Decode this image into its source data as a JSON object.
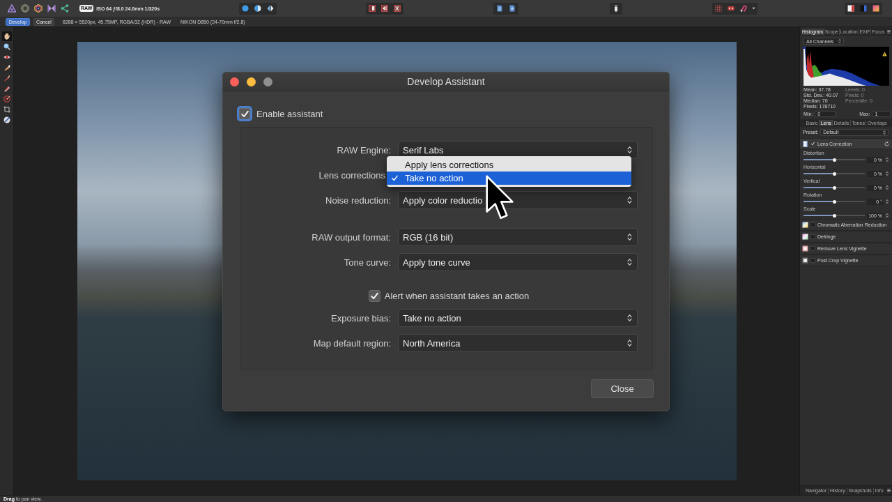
{
  "toolbar": {
    "raw_badge": "RAW",
    "exposure_info": "ISO 64 ƒ/8.0 24.0mm 1/320s"
  },
  "context_bar": {
    "buttons": [
      {
        "label": "Develop",
        "selected": true
      },
      {
        "label": "Cancel",
        "selected": false
      }
    ],
    "image_info": "8288 × 5520px, 45.75MP, RGBA/32 (HDR) - RAW",
    "camera_info": "NIKON D850 (24-70mm f/2.8)"
  },
  "tools": [
    {
      "selected": true
    },
    {
      "selected": false
    },
    {
      "selected": false
    },
    {
      "selected": false
    },
    {
      "selected": false
    },
    {
      "selected": false
    },
    {
      "selected": false
    },
    {
      "selected": false
    },
    {
      "selected": false
    }
  ],
  "dialog": {
    "title": "Develop Assistant",
    "window_buttons": [
      {
        "kind": "close",
        "disabled": false
      },
      {
        "kind": "minimize",
        "disabled": false
      },
      {
        "kind": "zoom",
        "disabled": true
      }
    ],
    "enable_assistant": {
      "label": "Enable assistant",
      "checked": true,
      "focused": true
    },
    "sections": [
      {
        "rows": [
          {
            "kind": "popup",
            "label": "RAW Engine:",
            "value": "Serif Labs"
          },
          {
            "kind": "popup",
            "label": "Lens corrections",
            "menu": [
              {
                "label": "Apply lens corrections",
                "selected": false
              },
              {
                "label": "Take no action",
                "selected": true
              }
            ]
          },
          {
            "kind": "popup",
            "label": "Noise reduction:",
            "value": "Apply color reductio"
          }
        ]
      },
      {
        "rows": [
          {
            "kind": "popup",
            "label": "RAW output format:",
            "value": "RGB (16 bit)"
          },
          {
            "kind": "popup",
            "label": "Tone curve:",
            "value": "Apply tone curve"
          }
        ]
      },
      {
        "rows": [
          {
            "kind": "checkbox",
            "label": "Alert when assistant takes an action",
            "checked": true
          },
          {
            "kind": "popup",
            "label": "Exposure bias:",
            "value": "Take no action"
          },
          {
            "kind": "popup",
            "label": "Map default region:",
            "value": "North America"
          }
        ]
      }
    ],
    "close_button": "Close"
  },
  "right_panel": {
    "tabs": [
      {
        "label": "Histogram",
        "selected": true
      },
      {
        "label": "Scope",
        "selected": false
      },
      {
        "label": "Location",
        "selected": false
      },
      {
        "label": "EXIF",
        "selected": false
      },
      {
        "label": "Focus",
        "selected": false
      }
    ],
    "channel_select": "All Channels",
    "stats": {
      "left": [
        {
          "text": "Mean: 37.78",
          "disabled": false
        },
        {
          "text": "Std. Dev.: 40.07",
          "disabled": false
        },
        {
          "text": "Median: 70",
          "disabled": false
        },
        {
          "text": "Pixels: 178710",
          "disabled": false
        }
      ],
      "right": [
        {
          "text": "Levels: 0",
          "disabled": true
        },
        {
          "text": "Pixels: 0",
          "disabled": true
        },
        {
          "text": "Percentile: 0",
          "disabled": true
        }
      ]
    },
    "min": {
      "label": "Min:",
      "value": "0"
    },
    "max": {
      "label": "Max:",
      "value": "1"
    },
    "adjust_tabs": [
      {
        "label": "Basic",
        "selected": false
      },
      {
        "label": "Lens",
        "selected": true
      },
      {
        "label": "Details",
        "selected": false
      },
      {
        "label": "Tones",
        "selected": false
      },
      {
        "label": "Overlays",
        "selected": false
      }
    ],
    "preset": {
      "label": "Preset:",
      "value": "Default"
    },
    "sections": [
      {
        "title": "Lens Correction",
        "checked": true,
        "expanded": true,
        "sliders": [
          {
            "label": "Distortion",
            "level": 0.5,
            "reading": "0 %"
          },
          {
            "label": "Horizontal",
            "level": 0.5,
            "reading": "0 %"
          },
          {
            "label": "Vertical",
            "level": 0.5,
            "reading": "0 %"
          },
          {
            "label": "Rotation",
            "level": 0.5,
            "reading": "0 °"
          },
          {
            "label": "Scale",
            "level": 0.5,
            "reading": "100 %"
          }
        ]
      },
      {
        "title": "Chromatic Aberration Reduction",
        "checked": false,
        "expanded": false
      },
      {
        "title": "Defringe",
        "checked": false,
        "expanded": false
      },
      {
        "title": "Remove Lens Vignette",
        "checked": false,
        "expanded": false
      },
      {
        "title": "Post Crop Vignette",
        "checked": false,
        "expanded": false
      }
    ],
    "bottom_tabs": [
      "Navigator",
      "History",
      "Snapshots",
      "Info"
    ]
  },
  "status_bar": "**Drag** to pan view."
}
